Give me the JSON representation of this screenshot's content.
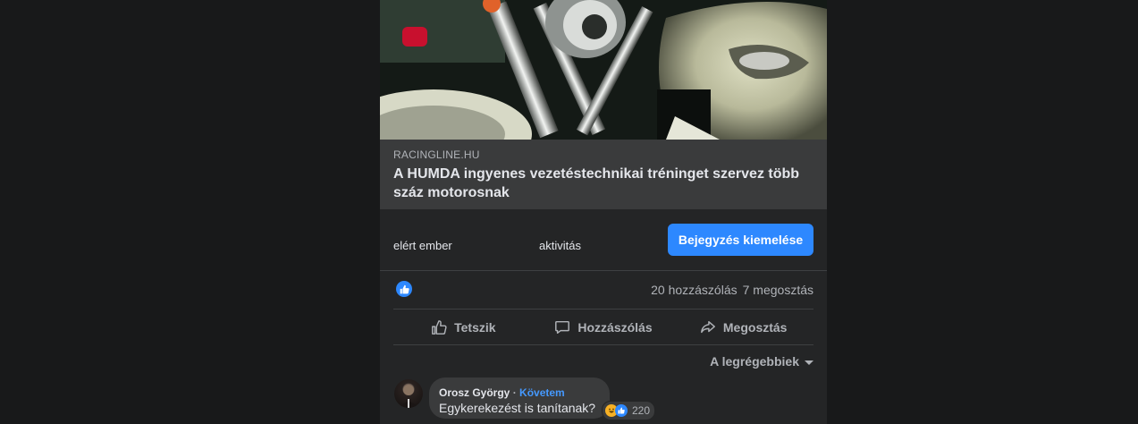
{
  "post": {
    "link_preview": {
      "domain": "RACINGLINE.HU",
      "title": "A HUMDA ingyenes vezetéstechnikai tréninget szervez több száz motorosnak"
    },
    "insights": {
      "reached_label": "elért ember",
      "activity_label": "aktivitás",
      "boost_button": "Bejegyzés kiemelése"
    },
    "summary": {
      "reaction_icon": "like-icon",
      "comments": "20 hozzászólás",
      "shares": "7 megosztás"
    },
    "actions": {
      "like": "Tetszik",
      "comment": "Hozzászólás",
      "share": "Megosztás"
    },
    "sort": {
      "label": "A legrégebbiek"
    },
    "comments": [
      {
        "author": "Orosz György",
        "separator": "·",
        "follow": "Követem",
        "text": "Egykerekezést is tanítanak?",
        "reactions": [
          "haha-icon",
          "like-icon"
        ],
        "reaction_count": "220"
      }
    ]
  },
  "colors": {
    "background": "#18191a",
    "card": "#242526",
    "accent": "#2d88ff",
    "link_box": "#3a3b3c"
  }
}
